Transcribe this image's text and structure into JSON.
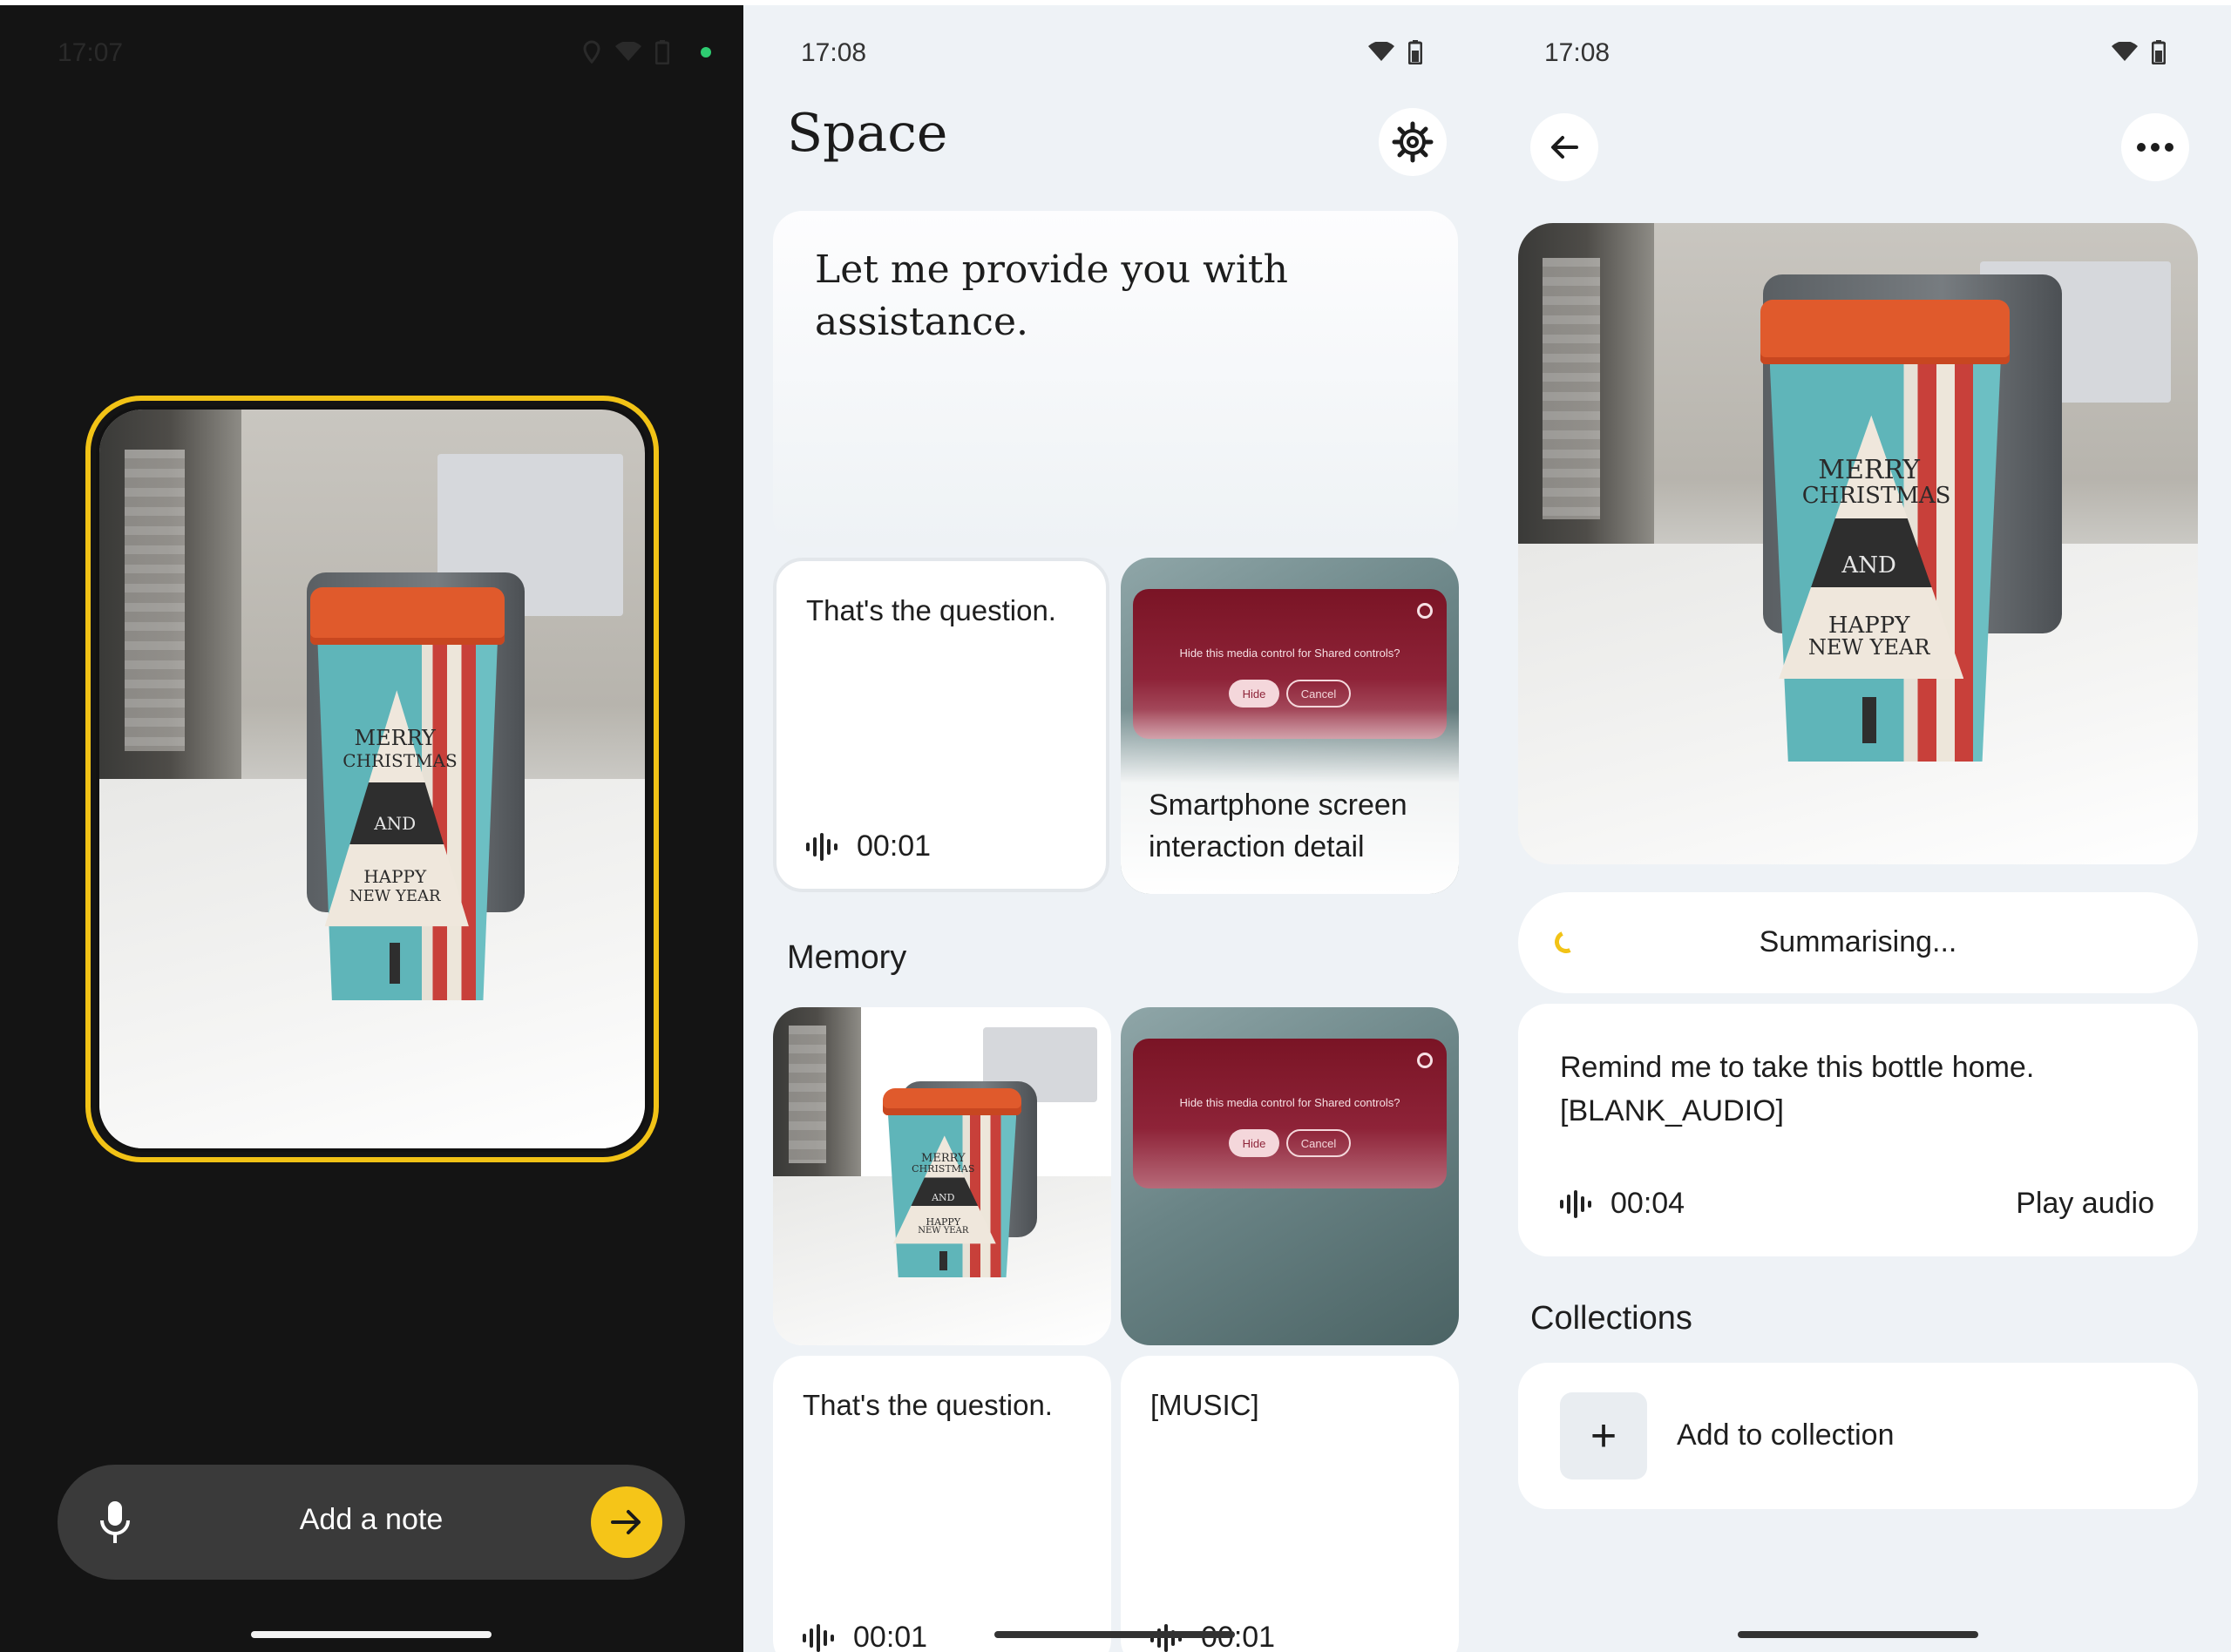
{
  "screen1": {
    "status_time": "17:07",
    "note_input": {
      "placeholder": "Add a note"
    },
    "icons": {
      "mic": "mic-icon",
      "send": "arrow-right-icon"
    },
    "accent": "#f5c518"
  },
  "screen2": {
    "status_time": "17:08",
    "title": "Space",
    "assist_text": "Let me provide you with assistance.",
    "cards": [
      {
        "text": "That's the question.",
        "duration": "00:01"
      },
      {
        "caption": "Smartphone screen interaction detail",
        "dialog": {
          "question": "Hide this media control for Shared controls?",
          "hide": "Hide",
          "cancel": "Cancel"
        }
      }
    ],
    "memory_label": "Memory",
    "memory_cards": [
      {
        "dialog": {
          "question": "Hide this media control for Shared controls?",
          "hide": "Hide",
          "cancel": "Cancel"
        }
      },
      {
        "text": "That's the question.",
        "duration": "00:01"
      },
      {
        "text": "[MUSIC]",
        "duration": "00:01"
      }
    ]
  },
  "screen3": {
    "status_time": "17:08",
    "summarising": "Summarising...",
    "transcript": "Remind me to take this bottle home. [BLANK_AUDIO]",
    "duration": "00:04",
    "play_audio": "Play audio",
    "collections_label": "Collections",
    "add_to_collection": "Add to collection"
  },
  "cup_text": {
    "line1": "MERRY",
    "line2": "CHRISTMAS",
    "line3": "AND",
    "line4": "HAPPY",
    "line5": "NEW YEAR"
  }
}
